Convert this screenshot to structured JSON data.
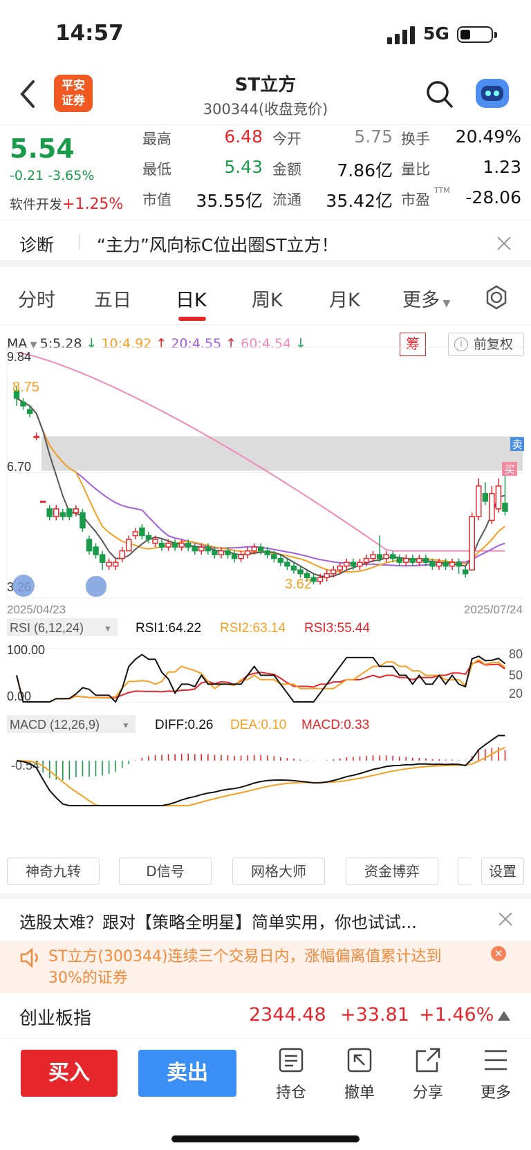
{
  "status": {
    "time": "14:57",
    "network": "5G"
  },
  "header": {
    "title": "ST立方",
    "subtitle": "300344(收盘竞价)",
    "logo_line1": "平安",
    "logo_line2": "证券"
  },
  "quote": {
    "price": "5.54",
    "change": "-0.21 -3.65%",
    "industry": "软件开发",
    "industry_change": "+1.25%",
    "fields": [
      {
        "label": "最高",
        "value": "6.48"
      },
      {
        "label": "今开",
        "value": "5.75"
      },
      {
        "label": "换手",
        "value": "20.49%"
      },
      {
        "label": "最低",
        "value": "5.43"
      },
      {
        "label": "金额",
        "value": "7.86亿"
      },
      {
        "label": "量比",
        "value": "1.23"
      },
      {
        "label": "市值",
        "value": "35.55亿"
      },
      {
        "label": "流通",
        "value": "35.42亿"
      },
      {
        "label": "市盈",
        "value": "-28.06"
      }
    ],
    "ttm": "TTM"
  },
  "diagnosis": {
    "label": "诊断",
    "text": "“主力”风向标C位出圈ST立方！"
  },
  "tabs": [
    "分时",
    "五日",
    "日K",
    "周K",
    "月K",
    "更多"
  ],
  "ma": {
    "label": "MA",
    "ma5": "5:5.28",
    "ma10": "10:4.92",
    "ma20": "20:4.55",
    "ma60": "60:4.54",
    "chou": "筹",
    "fuquan": "前复权"
  },
  "chart_data": {
    "type": "candlestick",
    "ymax_label": "9.84",
    "ymid_label": "6.70",
    "ymin_label": "3.26",
    "high_mark": "8.75",
    "low_mark": "3.62",
    "start_date": "2025/04/23",
    "end_date": "2025/07/24",
    "sell_tag": "卖",
    "buy_tag": "买",
    "candles": [
      [
        8.7,
        8.5,
        8.8,
        8.3
      ],
      [
        8.4,
        8.3,
        8.5,
        8.2
      ],
      [
        8.2,
        8.1,
        8.3,
        8.0
      ],
      [
        7.5,
        7.5,
        7.6,
        7.4
      ],
      [
        5.8,
        5.8,
        5.8,
        5.8
      ],
      [
        5.6,
        5.4,
        5.7,
        5.3
      ],
      [
        5.4,
        5.6,
        5.7,
        5.3
      ],
      [
        5.5,
        5.4,
        5.6,
        5.3
      ],
      [
        5.6,
        5.4,
        5.6,
        5.3
      ],
      [
        5.5,
        5.6,
        5.7,
        5.4
      ],
      [
        5.5,
        5.1,
        5.6,
        5.0
      ],
      [
        4.8,
        4.5,
        4.9,
        4.4
      ],
      [
        4.6,
        4.4,
        4.7,
        4.3
      ],
      [
        4.4,
        4.2,
        4.5,
        4.0
      ],
      [
        4.1,
        4.2,
        4.3,
        4.0
      ],
      [
        4.1,
        4.2,
        4.3,
        4.0
      ],
      [
        4.3,
        4.5,
        4.6,
        4.2
      ],
      [
        4.5,
        4.8,
        4.9,
        4.5
      ],
      [
        4.9,
        5.0,
        5.1,
        4.8
      ],
      [
        5.1,
        4.9,
        5.2,
        4.8
      ],
      [
        4.9,
        4.8,
        5.0,
        4.7
      ],
      [
        4.7,
        4.8,
        4.9,
        4.6
      ],
      [
        4.7,
        4.6,
        4.8,
        4.5
      ],
      [
        4.6,
        4.7,
        4.8,
        4.5
      ],
      [
        4.7,
        4.6,
        4.8,
        4.5
      ],
      [
        4.6,
        4.7,
        4.8,
        4.5
      ],
      [
        4.7,
        4.6,
        4.8,
        4.5
      ],
      [
        4.6,
        4.5,
        4.7,
        4.4
      ],
      [
        4.5,
        4.6,
        4.7,
        4.4
      ],
      [
        4.6,
        4.5,
        4.7,
        4.4
      ],
      [
        4.5,
        4.4,
        4.6,
        4.3
      ],
      [
        4.4,
        4.5,
        4.6,
        4.3
      ],
      [
        4.5,
        4.4,
        4.6,
        4.3
      ],
      [
        4.4,
        4.3,
        4.5,
        4.2
      ],
      [
        4.3,
        4.4,
        4.5,
        4.2
      ],
      [
        4.4,
        4.5,
        4.6,
        4.3
      ],
      [
        4.5,
        4.6,
        4.7,
        4.4
      ],
      [
        4.6,
        4.5,
        4.7,
        4.4
      ],
      [
        4.5,
        4.4,
        4.6,
        4.3
      ],
      [
        4.4,
        4.3,
        4.5,
        4.2
      ],
      [
        4.3,
        4.2,
        4.4,
        4.1
      ],
      [
        4.2,
        4.1,
        4.3,
        4.0
      ],
      [
        4.1,
        4.0,
        4.2,
        3.9
      ],
      [
        4.0,
        3.9,
        4.1,
        3.8
      ],
      [
        3.9,
        3.8,
        4.0,
        3.7
      ],
      [
        3.8,
        3.7,
        3.9,
        3.62
      ],
      [
        3.7,
        3.8,
        3.9,
        3.62
      ],
      [
        3.8,
        3.9,
        4.0,
        3.7
      ],
      [
        3.9,
        4.0,
        4.1,
        3.8
      ],
      [
        4.0,
        4.1,
        4.2,
        3.9
      ],
      [
        4.1,
        4.2,
        4.3,
        4.0
      ],
      [
        4.2,
        4.1,
        4.3,
        4.0
      ],
      [
        4.1,
        4.2,
        4.3,
        4.0
      ],
      [
        4.2,
        4.3,
        4.4,
        4.1
      ],
      [
        4.3,
        4.4,
        4.5,
        4.2
      ],
      [
        4.4,
        4.3,
        4.9,
        4.2
      ],
      [
        4.3,
        4.4,
        4.5,
        4.2
      ],
      [
        4.4,
        4.3,
        4.5,
        4.2
      ],
      [
        4.3,
        4.2,
        4.4,
        4.1
      ],
      [
        4.2,
        4.3,
        4.4,
        4.1
      ],
      [
        4.3,
        4.2,
        4.4,
        4.1
      ],
      [
        4.2,
        4.3,
        4.4,
        4.1
      ],
      [
        4.3,
        4.2,
        4.4,
        4.1
      ],
      [
        4.2,
        4.1,
        4.3,
        4.0
      ],
      [
        4.1,
        4.2,
        4.3,
        4.0
      ],
      [
        4.2,
        4.1,
        4.3,
        4.0
      ],
      [
        4.1,
        4.2,
        4.3,
        4.0
      ],
      [
        4.2,
        4.1,
        4.3,
        3.9
      ],
      [
        4.0,
        3.9,
        4.1,
        3.8
      ],
      [
        4.0,
        5.4,
        5.5,
        4.0
      ],
      [
        5.4,
        6.2,
        6.4,
        5.3
      ],
      [
        6.0,
        5.8,
        6.3,
        5.7
      ],
      [
        5.3,
        6.0,
        6.2,
        5.2
      ],
      [
        5.6,
        6.2,
        6.4,
        5.5
      ],
      [
        5.75,
        5.54,
        6.48,
        5.43
      ]
    ],
    "rsi": {
      "label": "RSI (6,12,24)",
      "rsi1": "RSI1:64.22",
      "rsi2": "RSI2:63.14",
      "rsi3": "RSI3:55.44",
      "top": "100.00",
      "bottom": "0.00",
      "l80": "80",
      "l50": "50",
      "l20": "20"
    },
    "macd": {
      "label": "MACD (12,26,9)",
      "diff": "DIFF:0.26",
      "dea": "DEA:0.10",
      "macd": "MACD:0.33",
      "ylabel": "-0.54"
    }
  },
  "tools": [
    "神奇九转",
    "D信号",
    "网格大师",
    "资金博弈",
    "设置"
  ],
  "promo": "选股太难？跟对【策略全明星】简单实用，你也试试...",
  "alert": {
    "line1": "ST立方(300344)连续三个交易日内，涨幅偏离值累计达到",
    "line2": "30%的证券"
  },
  "index": {
    "name": "创业板指",
    "value": "2344.48",
    "change": "+33.81",
    "pct": "+1.46%"
  },
  "bottom": {
    "buy": "买入",
    "sell": "卖出",
    "items": [
      "持仓",
      "撤单",
      "分享",
      "更多"
    ]
  }
}
